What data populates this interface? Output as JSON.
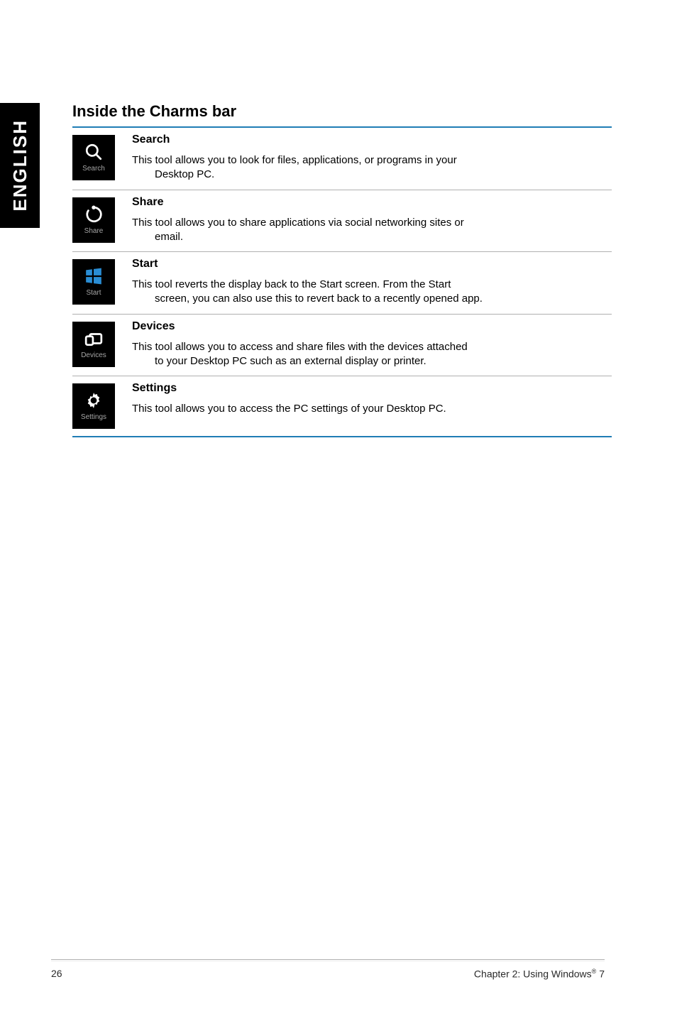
{
  "sideTab": "ENGLISH",
  "sectionTitle": "Inside the Charms bar",
  "charms": [
    {
      "tileLabel": "Search",
      "heading": "Search",
      "desc1": "This tool allows you to look for files, applications, or programs in your",
      "desc2": "Desktop PC."
    },
    {
      "tileLabel": "Share",
      "heading": "Share",
      "desc1": "This tool allows you to share applications via social networking sites or",
      "desc2": "email."
    },
    {
      "tileLabel": "Start",
      "heading": "Start",
      "desc1": "This tool reverts the display back to the Start screen. From the Start",
      "desc2": "screen, you can also use this to revert back to a recently opened app."
    },
    {
      "tileLabel": "Devices",
      "heading": "Devices",
      "desc1": "This tool allows you to access and share files with the devices attached",
      "desc2": "to your Desktop PC such as an external display or printer."
    },
    {
      "tileLabel": "Settings",
      "heading": "Settings",
      "desc1": "This tool allows you to access the PC settings of your Desktop PC.",
      "desc2": ""
    }
  ],
  "footer": {
    "pageNumber": "26",
    "chapterPrefix": "Chapter 2: Using Windows",
    "chapterSuffix": " 7"
  }
}
